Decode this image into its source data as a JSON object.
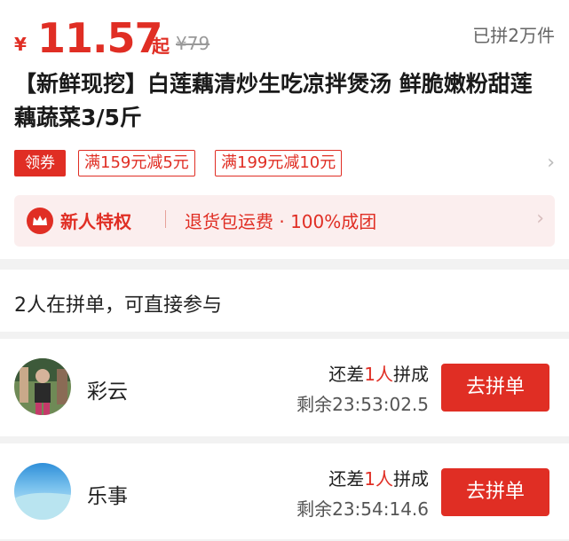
{
  "product": {
    "currency": "¥",
    "price": "11.57",
    "price_suffix": "起",
    "original_price": "¥79",
    "sold": "已拼2万件",
    "title": "【新鲜现挖】白莲藕清炒生吃凉拌煲汤 鲜脆嫩粉甜莲藕蔬菜3/5斤"
  },
  "coupons": {
    "label": "领券",
    "items": [
      "满159元减5元",
      "满199元减10元"
    ]
  },
  "privilege": {
    "title": "新人特权",
    "text": "退货包运费 · 100%成团"
  },
  "groups": {
    "heading": "2人在拼单，可直接参与",
    "rows": [
      {
        "name": "彩云",
        "need_prefix": "还差",
        "need_count": "1人",
        "need_suffix": "拼成",
        "remaining": "剩余23:53:02.5",
        "button": "去拼单"
      },
      {
        "name": "乐事",
        "need_prefix": "还差",
        "need_count": "1人",
        "need_suffix": "拼成",
        "remaining": "剩余23:54:14.6",
        "button": "去拼单"
      }
    ]
  },
  "icons": {
    "crown": "crown-icon",
    "chevron": "chevron-right-icon"
  },
  "colors": {
    "accent": "#e02e24",
    "privilege_bg": "#fbeeee"
  }
}
